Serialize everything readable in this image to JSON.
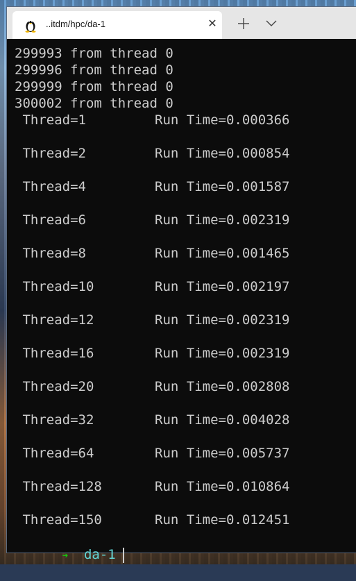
{
  "tab": {
    "title": "..itdm/hpc/da-1",
    "icon": "linux-tux-icon"
  },
  "output": {
    "thread_lines": [
      "299993 from thread 0",
      "299996 from thread 0",
      "299999 from thread 0",
      "300002 from thread 0"
    ],
    "results": [
      {
        "thread": " Thread=1",
        "time": "Run Time=0.000366"
      },
      {
        "thread": " Thread=2",
        "time": "Run Time=0.000854"
      },
      {
        "thread": " Thread=4",
        "time": "Run Time=0.001587"
      },
      {
        "thread": " Thread=6",
        "time": "Run Time=0.002319"
      },
      {
        "thread": " Thread=8",
        "time": "Run Time=0.001465"
      },
      {
        "thread": " Thread=10",
        "time": "Run Time=0.002197"
      },
      {
        "thread": " Thread=12",
        "time": "Run Time=0.002319"
      },
      {
        "thread": " Thread=16",
        "time": "Run Time=0.002319"
      },
      {
        "thread": " Thread=20",
        "time": "Run Time=0.002808"
      },
      {
        "thread": " Thread=32",
        "time": "Run Time=0.004028"
      },
      {
        "thread": " Thread=64",
        "time": "Run Time=0.005737"
      },
      {
        "thread": " Thread=128",
        "time": "Run Time=0.010864"
      },
      {
        "thread": " Thread=150",
        "time": "Run Time=0.012451"
      }
    ]
  },
  "prompt": {
    "arrow": "➜",
    "directory": "da-1"
  },
  "colors": {
    "terminal_bg": "#0c0c0c",
    "text": "#cccccc",
    "prompt_arrow": "#16c60c",
    "prompt_dir": "#61d6d6",
    "titlebar": "#e6e6e6"
  }
}
